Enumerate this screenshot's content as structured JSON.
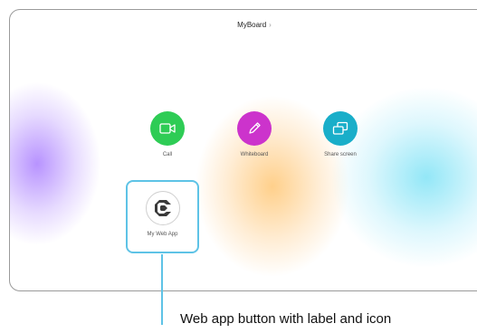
{
  "header": {
    "title": "MyBoard",
    "chevron": "›"
  },
  "actions": [
    {
      "label": "Call",
      "icon": "camera-icon",
      "color": "#2ecc55"
    },
    {
      "label": "Whiteboard",
      "icon": "pencil-icon",
      "color": "#cc33cc"
    },
    {
      "label": "Share screen",
      "icon": "share-screen-icon",
      "color": "#19aec9"
    }
  ],
  "web_app": {
    "label": "My Web App",
    "icon": "web-app-logo-icon",
    "border_color": "#5ec3e6"
  },
  "callout": {
    "text": "Web app button with label and icon"
  }
}
